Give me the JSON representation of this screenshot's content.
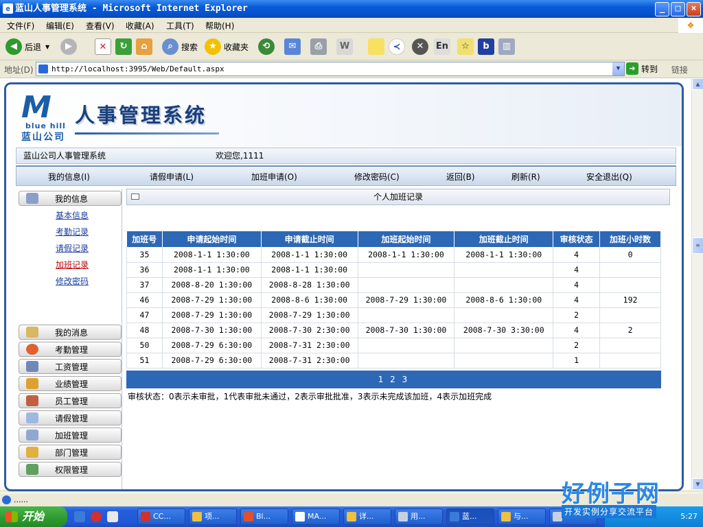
{
  "window": {
    "title": "蓝山人事管理系统 - Microsoft Internet Explorer",
    "min": "_",
    "max": "□",
    "close": "×"
  },
  "menubar": [
    "文件(F)",
    "编辑(E)",
    "查看(V)",
    "收藏(A)",
    "工具(T)",
    "帮助(H)"
  ],
  "toolbar": {
    "back": "后退",
    "search": "搜索",
    "favorites": "收藏夹"
  },
  "address": {
    "label": "地址(D)",
    "url": "http://localhost:3995/Web/Default.aspx",
    "go": "转到",
    "links": "链接"
  },
  "app": {
    "logo_en": "blue hill",
    "logo_cn": "蓝山公司",
    "title": "人事管理系统",
    "company": "蓝山公司人事管理系统",
    "welcome": "欢迎您,1111",
    "nav": [
      "我的信息(I)",
      "请假申请(L)",
      "加班申请(O)",
      "修改密码(C)",
      "返回(B)",
      "刷新(R)",
      "安全退出(Q)"
    ]
  },
  "sidebar": {
    "my_info": "我的信息",
    "sub_items": [
      "基本信息",
      "考勤记录",
      "请假记录",
      "加班记录",
      "修改密码"
    ],
    "active_sub": "加班记录",
    "groups": [
      "我的消息",
      "考勤管理",
      "工资管理",
      "业绩管理",
      "员工管理",
      "请假管理",
      "加班管理",
      "部门管理",
      "权限管理"
    ]
  },
  "panel": {
    "title": "个人加班记录",
    "columns": [
      "加班号",
      "申请起始时间",
      "申请截止时间",
      "加班起始时间",
      "加班截止时间",
      "审核状态",
      "加班小时数"
    ],
    "rows": [
      [
        "35",
        "2008-1-1 1:30:00",
        "2008-1-1 1:30:00",
        "2008-1-1 1:30:00",
        "2008-1-1 1:30:00",
        "4",
        "0"
      ],
      [
        "36",
        "2008-1-1 1:30:00",
        "2008-1-1 1:30:00",
        "",
        "",
        "4",
        ""
      ],
      [
        "37",
        "2008-8-20 1:30:00",
        "2008-8-28 1:30:00",
        "",
        "",
        "4",
        ""
      ],
      [
        "46",
        "2008-7-29 1:30:00",
        "2008-8-6 1:30:00",
        "2008-7-29 1:30:00",
        "2008-8-6 1:30:00",
        "4",
        "192"
      ],
      [
        "47",
        "2008-7-29 1:30:00",
        "2008-7-29 1:30:00",
        "",
        "",
        "2",
        ""
      ],
      [
        "48",
        "2008-7-30 1:30:00",
        "2008-7-30 2:30:00",
        "2008-7-30 1:30:00",
        "2008-7-30 3:30:00",
        "4",
        "2"
      ],
      [
        "50",
        "2008-7-29 6:30:00",
        "2008-7-31 2:30:00",
        "",
        "",
        "2",
        ""
      ],
      [
        "51",
        "2008-7-29 6:30:00",
        "2008-7-31 2:30:00",
        "",
        "",
        "1",
        ""
      ]
    ],
    "pager": "1 2 3",
    "legend": "审核状态：0表示未审批，1代表审批未通过，2表示审批批准，3表示未完成该加班，4表示加班完成"
  },
  "status": {
    "text": "......"
  },
  "taskbar": {
    "start": "开始",
    "tasks": [
      "CC...",
      "项...",
      "Bl...",
      "MA...",
      "详...",
      "用...",
      "蓝...",
      "与...",
      ""
    ],
    "clock": "5:27"
  },
  "watermark": {
    "big": "好例子网",
    "small": "开发实例分享交流平台"
  }
}
